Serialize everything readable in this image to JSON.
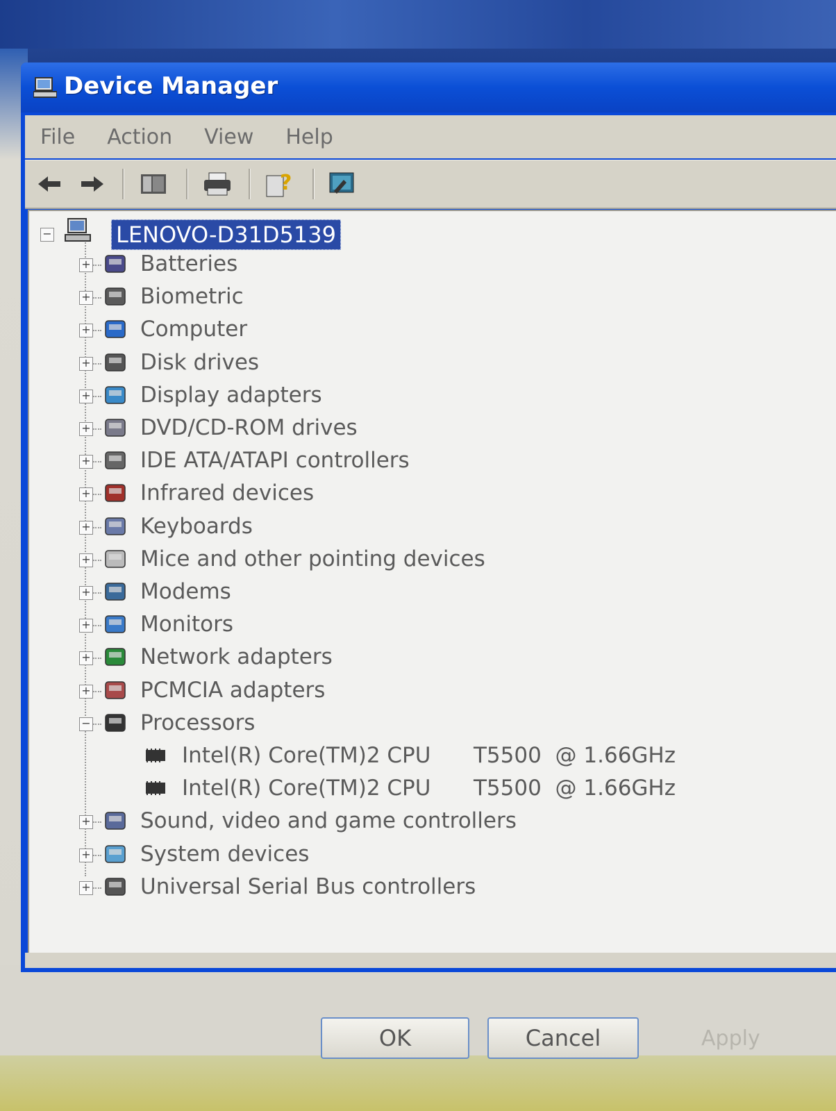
{
  "window": {
    "title": "Device Manager",
    "menu": [
      "File",
      "Action",
      "View",
      "Help"
    ]
  },
  "toolbar": {
    "buttons": [
      "back-icon",
      "forward-icon",
      "console-tree-icon",
      "print-icon",
      "help-icon",
      "scan-hardware-icon"
    ]
  },
  "tree": {
    "root": "LENOVO-D31D5139",
    "categories": [
      {
        "label": "Batteries",
        "icon": "battery-icon",
        "expanded": false
      },
      {
        "label": "Biometric",
        "icon": "biometric-icon",
        "expanded": false
      },
      {
        "label": "Computer",
        "icon": "computer-icon",
        "expanded": false
      },
      {
        "label": "Disk drives",
        "icon": "disk-drive-icon",
        "expanded": false
      },
      {
        "label": "Display adapters",
        "icon": "display-adapter-icon",
        "expanded": false
      },
      {
        "label": "DVD/CD-ROM drives",
        "icon": "dvd-drive-icon",
        "expanded": false
      },
      {
        "label": "IDE ATA/ATAPI controllers",
        "icon": "ide-controller-icon",
        "expanded": false
      },
      {
        "label": "Infrared devices",
        "icon": "infrared-icon",
        "expanded": false
      },
      {
        "label": "Keyboards",
        "icon": "keyboard-icon",
        "expanded": false
      },
      {
        "label": "Mice and other pointing devices",
        "icon": "mouse-icon",
        "expanded": false
      },
      {
        "label": "Modems",
        "icon": "modem-icon",
        "expanded": false
      },
      {
        "label": "Monitors",
        "icon": "monitor-icon",
        "expanded": false
      },
      {
        "label": "Network adapters",
        "icon": "network-adapter-icon",
        "expanded": false
      },
      {
        "label": "PCMCIA adapters",
        "icon": "pcmcia-icon",
        "expanded": false
      },
      {
        "label": "Processors",
        "icon": "processor-icon",
        "expanded": true
      },
      {
        "label": "Sound, video and game controllers",
        "icon": "sound-icon",
        "expanded": false
      },
      {
        "label": "System devices",
        "icon": "system-device-icon",
        "expanded": false
      },
      {
        "label": "Universal Serial Bus controllers",
        "icon": "usb-icon",
        "expanded": false
      }
    ],
    "processors": [
      {
        "name": "Intel(R) Core(TM)2 CPU",
        "model": "T5500  @ 1.66GHz"
      },
      {
        "name": "Intel(R) Core(TM)2 CPU",
        "model": "T5500  @ 1.66GHz"
      }
    ]
  },
  "dialog_buttons": {
    "ok": "OK",
    "cancel": "Cancel",
    "apply": "Apply"
  }
}
